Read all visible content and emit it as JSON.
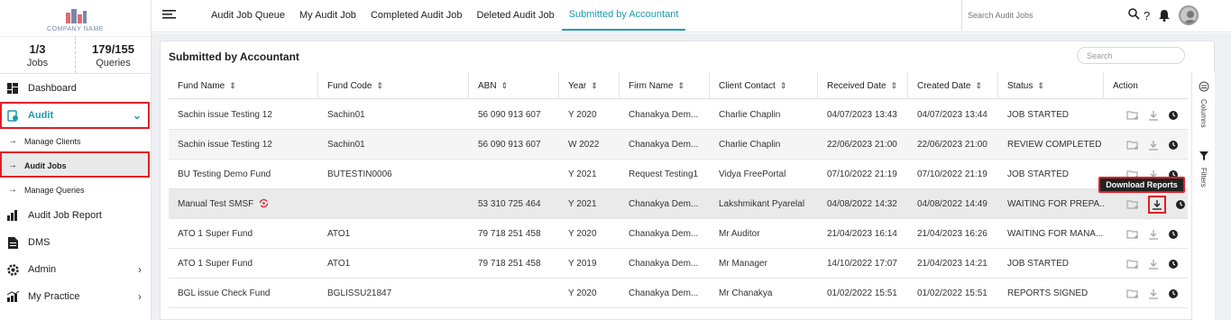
{
  "logo": {
    "name": "COMPANY NAME"
  },
  "stats": [
    {
      "value": "1/3",
      "label": "Jobs"
    },
    {
      "value": "179/155",
      "label": "Queries"
    }
  ],
  "sidebar": {
    "dashboard": "Dashboard",
    "audit": "Audit",
    "manage_clients": "Manage Clients",
    "audit_jobs": "Audit Jobs",
    "manage_queries": "Manage Queries",
    "audit_job_report": "Audit Job Report",
    "dms": "DMS",
    "admin": "Admin",
    "my_practice": "My Practice"
  },
  "tabs": [
    "Audit Job Queue",
    "My Audit Job",
    "Completed Audit Job",
    "Deleted Audit Job",
    "Submitted by Accountant"
  ],
  "search": {
    "placeholder": "Search Audit Jobs"
  },
  "panel": {
    "title": "Submitted by Accountant",
    "search_placeholder": "Search"
  },
  "columns": [
    "Fund Name",
    "Fund Code",
    "ABN",
    "Year",
    "Firm Name",
    "Client Contact",
    "Received Date",
    "Created Date",
    "Status",
    "Action"
  ],
  "rows": [
    {
      "fund_name": "Sachin issue Testing 12",
      "fund_code": "Sachin01",
      "abn": "56 090 913 607",
      "year": "Y 2020",
      "firm": "Chanakya Dem...",
      "contact": "Charlie Chaplin",
      "received": "04/07/2023 13:43",
      "created": "04/07/2023 13:44",
      "status": "JOB STARTED"
    },
    {
      "fund_name": "Sachin issue Testing 12",
      "fund_code": "Sachin01",
      "abn": "56 090 913 607",
      "year": "W 2022",
      "firm": "Chanakya Dem...",
      "contact": "Charlie Chaplin",
      "received": "22/06/2023 21:00",
      "created": "22/06/2023 21:00",
      "status": "REVIEW COMPLETED"
    },
    {
      "fund_name": "BU Testing Demo Fund",
      "fund_code": "BUTESTIN0006",
      "abn": "",
      "year": "Y 2021",
      "firm": "Request Testing1",
      "contact": "Vidya FreePortal",
      "received": "07/10/2022 21:19",
      "created": "07/10/2022 21:19",
      "status": "JOB STARTED"
    },
    {
      "fund_name": "Manual Test SMSF",
      "fund_code": "",
      "abn": "53 310 725 464",
      "year": "Y 2021",
      "firm": "Chanakya Dem...",
      "contact": "Lakshmikant Pyarelal",
      "received": "04/08/2022 14:32",
      "created": "04/08/2022 14:49",
      "status": "WAITING FOR PREPA..."
    },
    {
      "fund_name": "ATO 1 Super Fund",
      "fund_code": "ATO1",
      "abn": "79 718 251 458",
      "year": "Y 2020",
      "firm": "Chanakya Dem...",
      "contact": "Mr Auditor",
      "received": "21/04/2023 16:14",
      "created": "21/04/2023 16:26",
      "status": "WAITING FOR MANA..."
    },
    {
      "fund_name": "ATO 1 Super Fund",
      "fund_code": "ATO1",
      "abn": "79 718 251 458",
      "year": "Y 2019",
      "firm": "Chanakya Dem...",
      "contact": "Mr Manager",
      "received": "14/10/2022 17:07",
      "created": "21/04/2023 14:21",
      "status": "JOB STARTED"
    },
    {
      "fund_name": "BGL issue Check Fund",
      "fund_code": "BGLISSU21847",
      "abn": "",
      "year": "Y 2020",
      "firm": "Chanakya Dem...",
      "contact": "Mr Chanakya",
      "received": "01/02/2022 15:51",
      "created": "01/02/2022 15:51",
      "status": "REPORTS SIGNED"
    }
  ],
  "right_rail": {
    "columns": "Columns",
    "filters": "Filters"
  },
  "tooltip": "Download Reports",
  "annotations": [
    "1",
    "2",
    "3"
  ],
  "colors": {
    "accent": "#1a9bb0",
    "annotation": "#e01f26"
  }
}
